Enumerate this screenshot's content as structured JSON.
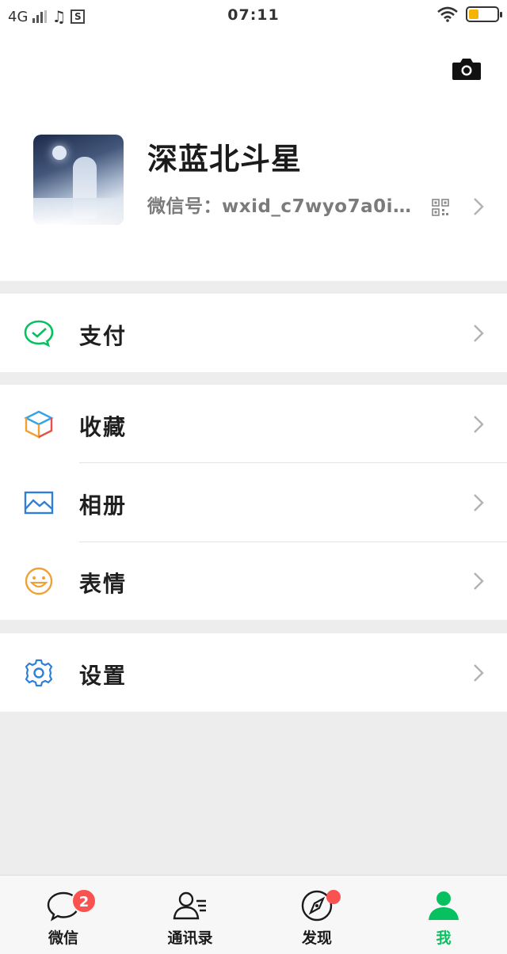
{
  "status_bar": {
    "network": "4G",
    "time": "07:11",
    "battery_color": "#f5b400"
  },
  "header": {
    "camera_icon": "camera-icon"
  },
  "profile": {
    "nickname": "深蓝北斗星",
    "wechat_id_label": "微信号：wxid_c7wyo7a0i…",
    "qr_icon": "qrcode-icon"
  },
  "menu": {
    "pay": {
      "label": "支付",
      "icon": "wechat-pay-icon",
      "color": "#07c160"
    },
    "favorites": {
      "label": "收藏",
      "icon": "cube-icon"
    },
    "album": {
      "label": "相册",
      "icon": "picture-icon",
      "color": "#2f7fd8"
    },
    "stickers": {
      "label": "表情",
      "icon": "smiley-icon",
      "color": "#f0a134"
    },
    "settings": {
      "label": "设置",
      "icon": "gear-icon",
      "color": "#2f7fd8"
    }
  },
  "tabbar": {
    "tabs": [
      {
        "label": "微信",
        "icon": "chat-bubble-icon",
        "badge": "2"
      },
      {
        "label": "通讯录",
        "icon": "contacts-icon"
      },
      {
        "label": "发现",
        "icon": "compass-icon",
        "dot": true
      },
      {
        "label": "我",
        "icon": "person-icon",
        "active": true
      }
    ],
    "accent": "#07c160",
    "badge_color": "#fa5151"
  }
}
